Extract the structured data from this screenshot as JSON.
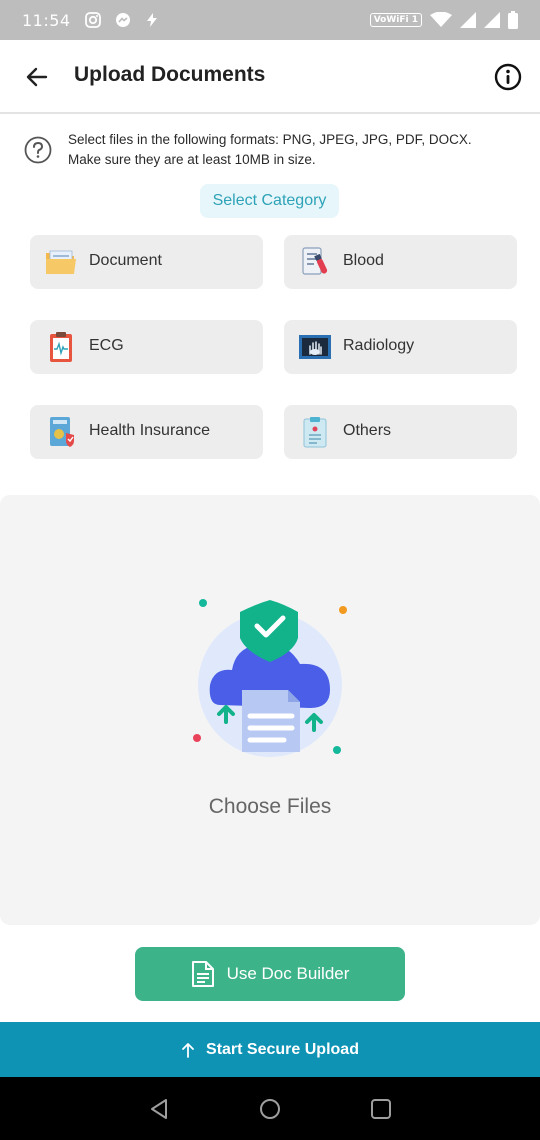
{
  "status_bar": {
    "time": "11:54",
    "network_label": "VoWiFi 1",
    "left_icons": [
      "instagram-icon",
      "messenger-icon",
      "bolt-icon"
    ],
    "right_icons": [
      "wifi-icon",
      "signal-icon",
      "signal-icon",
      "battery-icon"
    ]
  },
  "header": {
    "title": "Upload Documents",
    "back_icon": "arrow-left-icon",
    "info_icon": "info-circle-icon"
  },
  "hint": {
    "icon": "question-circle-icon",
    "line1": "Select files in the following formats: PNG, JPEG, JPG, PDF, DOCX.",
    "line2": "Make sure they are at least 10MB in size."
  },
  "select_category_label": "Select Category",
  "categories": [
    {
      "label": "Document",
      "icon": "folder-icon"
    },
    {
      "label": "Blood",
      "icon": "blood-test-icon"
    },
    {
      "label": "ECG",
      "icon": "ecg-clipboard-icon"
    },
    {
      "label": "Radiology",
      "icon": "xray-icon"
    },
    {
      "label": "Health Insurance",
      "icon": "insurance-icon"
    },
    {
      "label": "Others",
      "icon": "clipboard-icon"
    }
  ],
  "upload_area": {
    "label": "Choose Files",
    "illustration": "secure-cloud-upload-illustration"
  },
  "doc_builder_label": "Use Doc Builder",
  "start_upload_label": "Start Secure Upload",
  "colors": {
    "accent_teal": "#0e93b5",
    "green": "#3db38a",
    "select_category_text": "#2ea3b8",
    "tile_bg": "#ededed"
  }
}
